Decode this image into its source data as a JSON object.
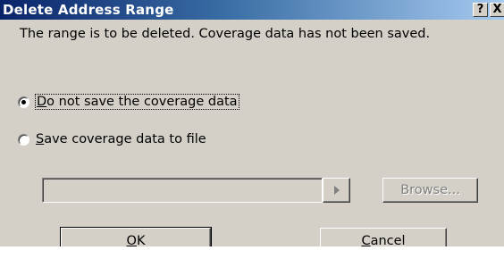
{
  "dialog": {
    "title": "Delete Address Range",
    "help_button": "?",
    "close_button": "X",
    "message": "The range is to be deleted. Coverage data has not been saved."
  },
  "options": [
    {
      "label_underlined": "D",
      "label_rest": "o not save the coverage data",
      "selected": true
    },
    {
      "label_underlined": "S",
      "label_rest": "ave coverage data to file",
      "selected": false
    }
  ],
  "file": {
    "path_value": "",
    "browse_label": "Browse..."
  },
  "buttons": {
    "ok_underlined": "O",
    "ok_rest": "K",
    "cancel_underlined": "C",
    "cancel_rest": "ancel"
  },
  "colors": {
    "titlebar_start": "#0a246a",
    "titlebar_end": "#a6caf0",
    "face": "#d4d0c8"
  }
}
